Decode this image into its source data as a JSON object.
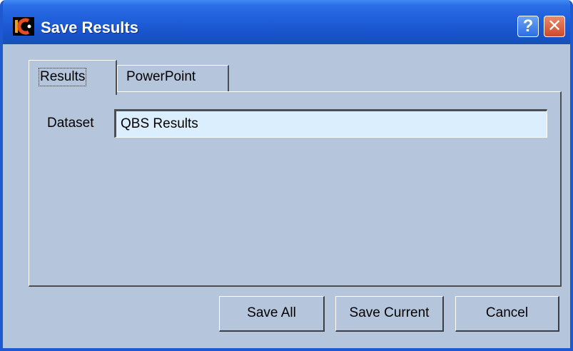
{
  "window": {
    "title": "Save Results",
    "help_symbol": "?",
    "close_symbol": "✕",
    "icons": {
      "app": "app-logo-icon",
      "help": "help-icon",
      "close": "close-icon"
    }
  },
  "tabs": [
    {
      "label": "Results",
      "selected": true
    },
    {
      "label": "PowerPoint",
      "selected": false
    }
  ],
  "form": {
    "dataset_label": "Dataset",
    "dataset_value": "QBS Results"
  },
  "buttons": {
    "save_all": "Save All",
    "save_current": "Save Current",
    "cancel": "Cancel"
  },
  "colors": {
    "titlebar": "#1f5fd9",
    "body": "#b5c6dc",
    "input_bg": "#daeefe",
    "close": "#d0482a"
  }
}
